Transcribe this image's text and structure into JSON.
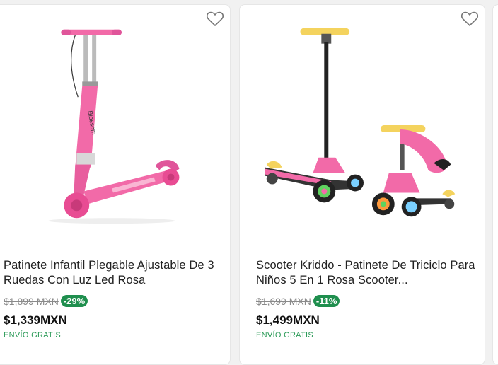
{
  "products": [
    {
      "title": "Patinete Infantil Plegable Ajustable De 3 Ruedas Con Luz Led Rosa",
      "old_price": "$1,899 MXN",
      "discount": "-29%",
      "price": "$1,339MXN",
      "shipping": "ENVÍO GRATIS",
      "image": "pink-folding-scooter",
      "favorite_icon": "heart-outline-icon"
    },
    {
      "title": "Scooter Kriddo - Patinete De Triciclo Para Niños 5 En 1 Rosa Scooter...",
      "old_price": "$1,699 MXN",
      "discount": "-11%",
      "price": "$1,499MXN",
      "shipping": "ENVÍO GRATIS",
      "image": "pink-tricycle-scooter-5-in-1",
      "favorite_icon": "heart-outline-icon"
    }
  ],
  "colors": {
    "discount_badge": "#1f8f4e",
    "shipping_text": "#2a9a57",
    "scooter_pink": "#f26aa8",
    "handle_yellow": "#f4d35e"
  }
}
